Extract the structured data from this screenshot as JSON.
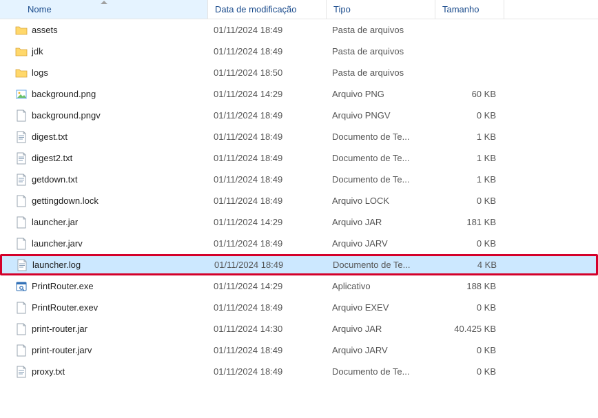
{
  "columns": {
    "name": "Nome",
    "date": "Data de modificação",
    "type": "Tipo",
    "size": "Tamanho"
  },
  "rows": [
    {
      "icon": "folder",
      "name": "assets",
      "date": "01/11/2024 18:49",
      "type": "Pasta de arquivos",
      "size": "",
      "selected": false,
      "highlight": false
    },
    {
      "icon": "folder",
      "name": "jdk",
      "date": "01/11/2024 18:49",
      "type": "Pasta de arquivos",
      "size": "",
      "selected": false,
      "highlight": false
    },
    {
      "icon": "folder",
      "name": "logs",
      "date": "01/11/2024 18:50",
      "type": "Pasta de arquivos",
      "size": "",
      "selected": false,
      "highlight": false
    },
    {
      "icon": "image",
      "name": "background.png",
      "date": "01/11/2024 14:29",
      "type": "Arquivo PNG",
      "size": "60 KB",
      "selected": false,
      "highlight": false
    },
    {
      "icon": "file",
      "name": "background.pngv",
      "date": "01/11/2024 18:49",
      "type": "Arquivo PNGV",
      "size": "0 KB",
      "selected": false,
      "highlight": false
    },
    {
      "icon": "text",
      "name": "digest.txt",
      "date": "01/11/2024 18:49",
      "type": "Documento de Te...",
      "size": "1 KB",
      "selected": false,
      "highlight": false
    },
    {
      "icon": "text",
      "name": "digest2.txt",
      "date": "01/11/2024 18:49",
      "type": "Documento de Te...",
      "size": "1 KB",
      "selected": false,
      "highlight": false
    },
    {
      "icon": "text",
      "name": "getdown.txt",
      "date": "01/11/2024 18:49",
      "type": "Documento de Te...",
      "size": "1 KB",
      "selected": false,
      "highlight": false
    },
    {
      "icon": "file",
      "name": "gettingdown.lock",
      "date": "01/11/2024 18:49",
      "type": "Arquivo LOCK",
      "size": "0 KB",
      "selected": false,
      "highlight": false
    },
    {
      "icon": "file",
      "name": "launcher.jar",
      "date": "01/11/2024 14:29",
      "type": "Arquivo JAR",
      "size": "181 KB",
      "selected": false,
      "highlight": false
    },
    {
      "icon": "file",
      "name": "launcher.jarv",
      "date": "01/11/2024 18:49",
      "type": "Arquivo JARV",
      "size": "0 KB",
      "selected": false,
      "highlight": false
    },
    {
      "icon": "text",
      "name": "launcher.log",
      "date": "01/11/2024 18:49",
      "type": "Documento de Te...",
      "size": "4 KB",
      "selected": true,
      "highlight": true
    },
    {
      "icon": "exe",
      "name": "PrintRouter.exe",
      "date": "01/11/2024 14:29",
      "type": "Aplicativo",
      "size": "188 KB",
      "selected": false,
      "highlight": false
    },
    {
      "icon": "file",
      "name": "PrintRouter.exev",
      "date": "01/11/2024 18:49",
      "type": "Arquivo EXEV",
      "size": "0 KB",
      "selected": false,
      "highlight": false
    },
    {
      "icon": "file",
      "name": "print-router.jar",
      "date": "01/11/2024 14:30",
      "type": "Arquivo JAR",
      "size": "40.425 KB",
      "selected": false,
      "highlight": false
    },
    {
      "icon": "file",
      "name": "print-router.jarv",
      "date": "01/11/2024 18:49",
      "type": "Arquivo JARV",
      "size": "0 KB",
      "selected": false,
      "highlight": false
    },
    {
      "icon": "text",
      "name": "proxy.txt",
      "date": "01/11/2024 18:49",
      "type": "Documento de Te...",
      "size": "0 KB",
      "selected": false,
      "highlight": false
    }
  ]
}
